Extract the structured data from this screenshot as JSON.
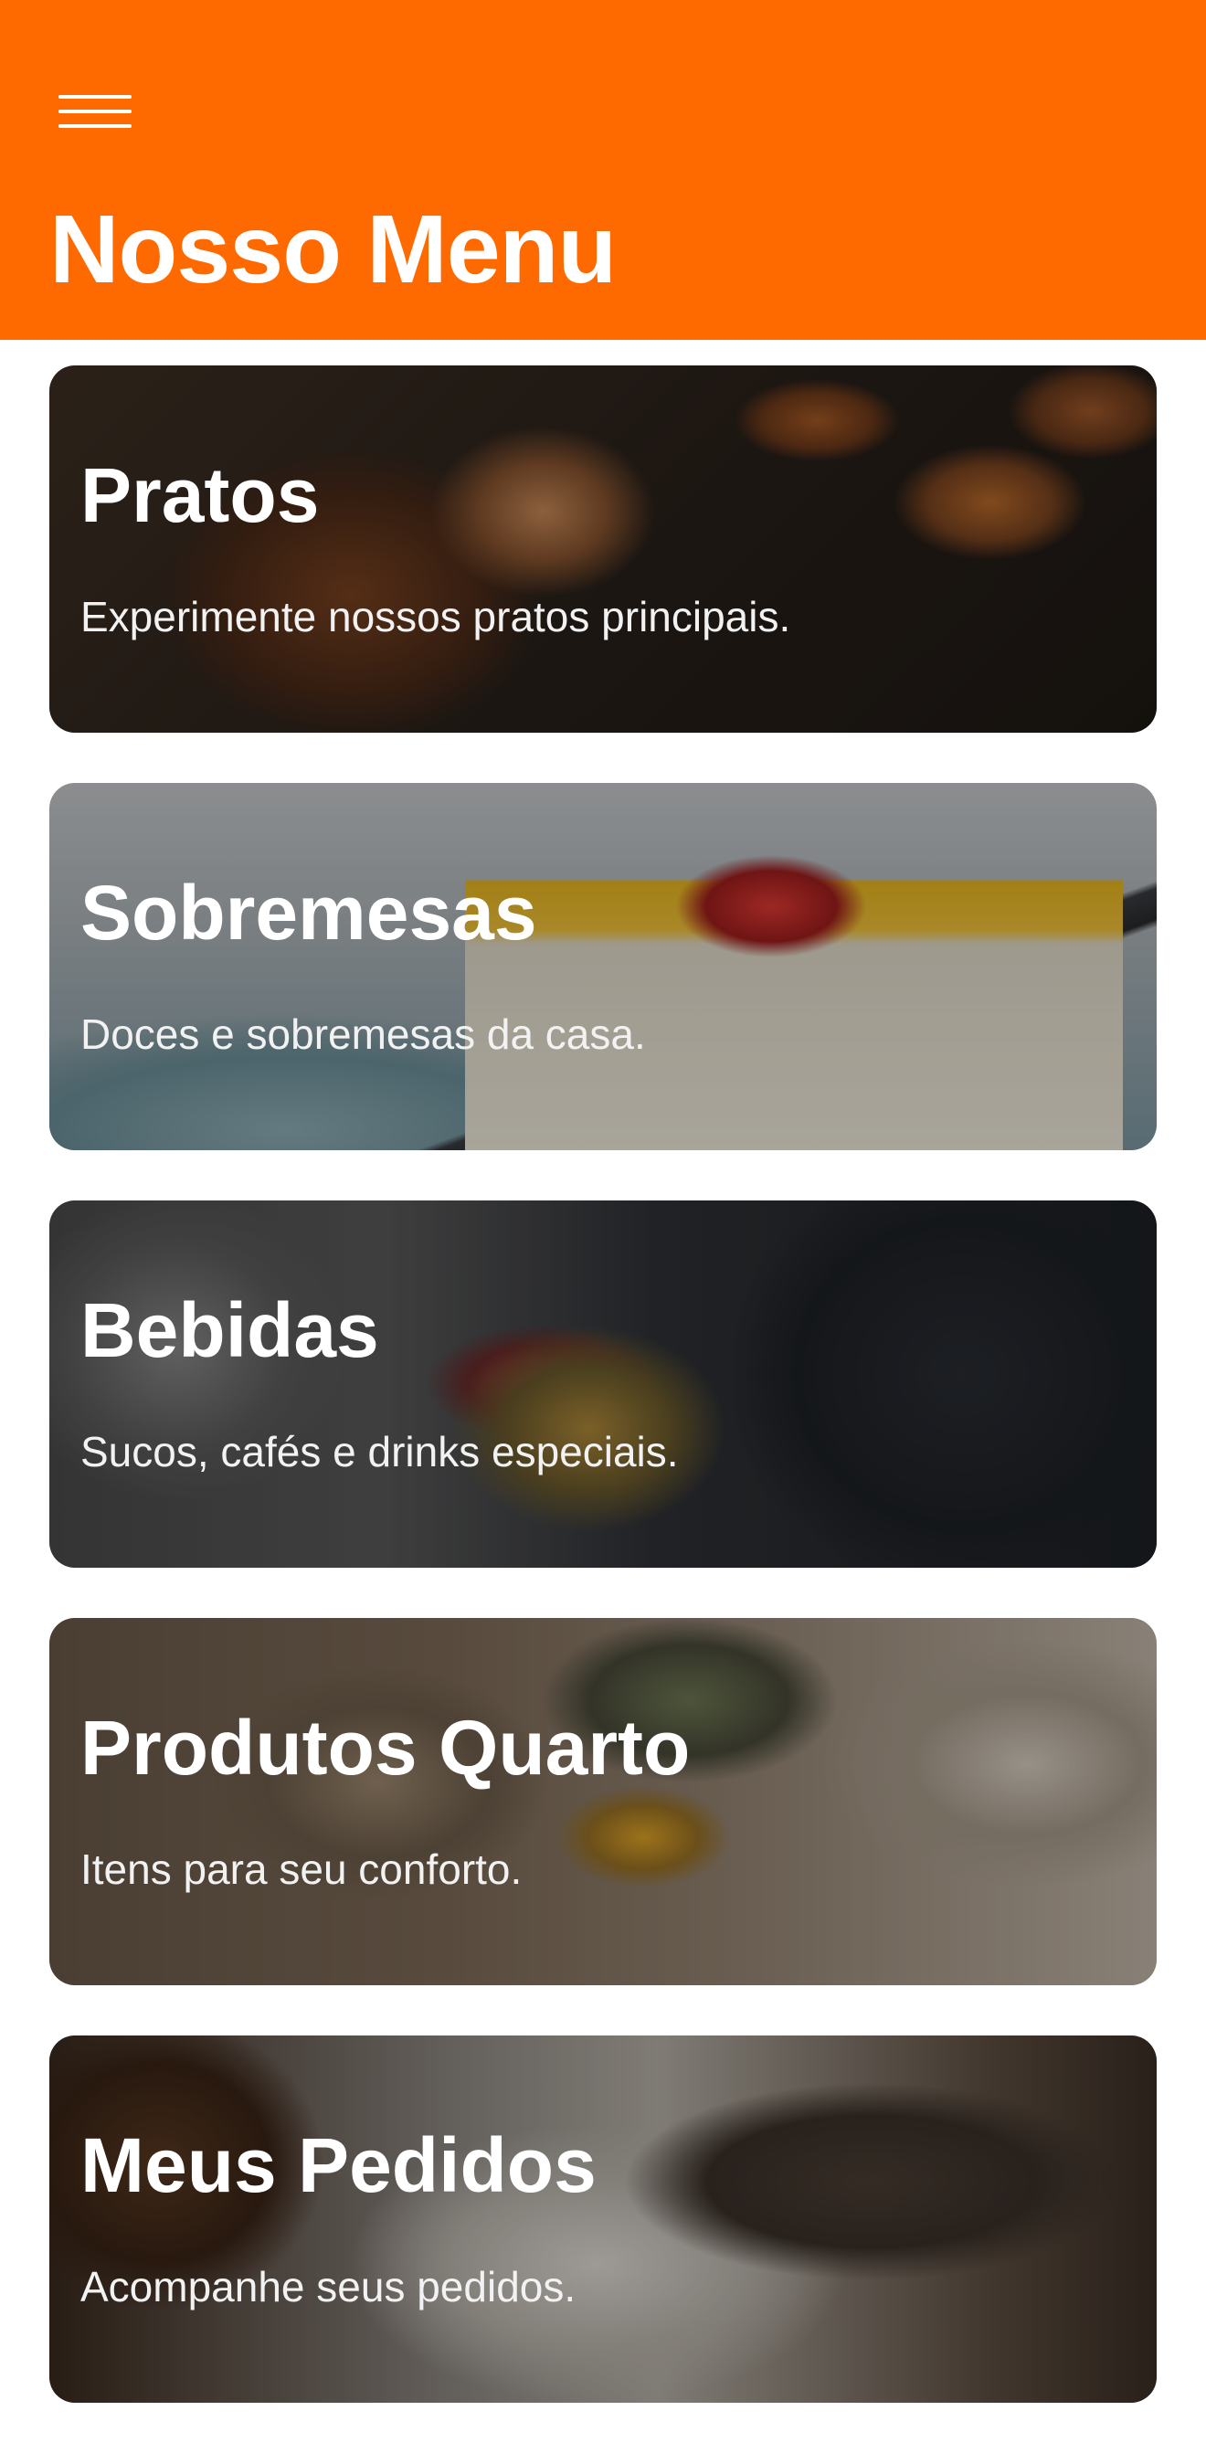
{
  "header": {
    "title": "Nosso Menu",
    "menu_icon": "hamburger-menu-icon",
    "background_color": "#ff6a00"
  },
  "categories": [
    {
      "title": "Pratos",
      "subtitle": "Experimente nossos pratos principais."
    },
    {
      "title": "Sobremesas",
      "subtitle": "Doces e sobremesas da casa."
    },
    {
      "title": "Bebidas",
      "subtitle": "Sucos, cafés e drinks especiais."
    },
    {
      "title": "Produtos Quarto",
      "subtitle": "Itens para seu conforto."
    },
    {
      "title": "Meus Pedidos",
      "subtitle": "Acompanhe seus pedidos."
    }
  ]
}
